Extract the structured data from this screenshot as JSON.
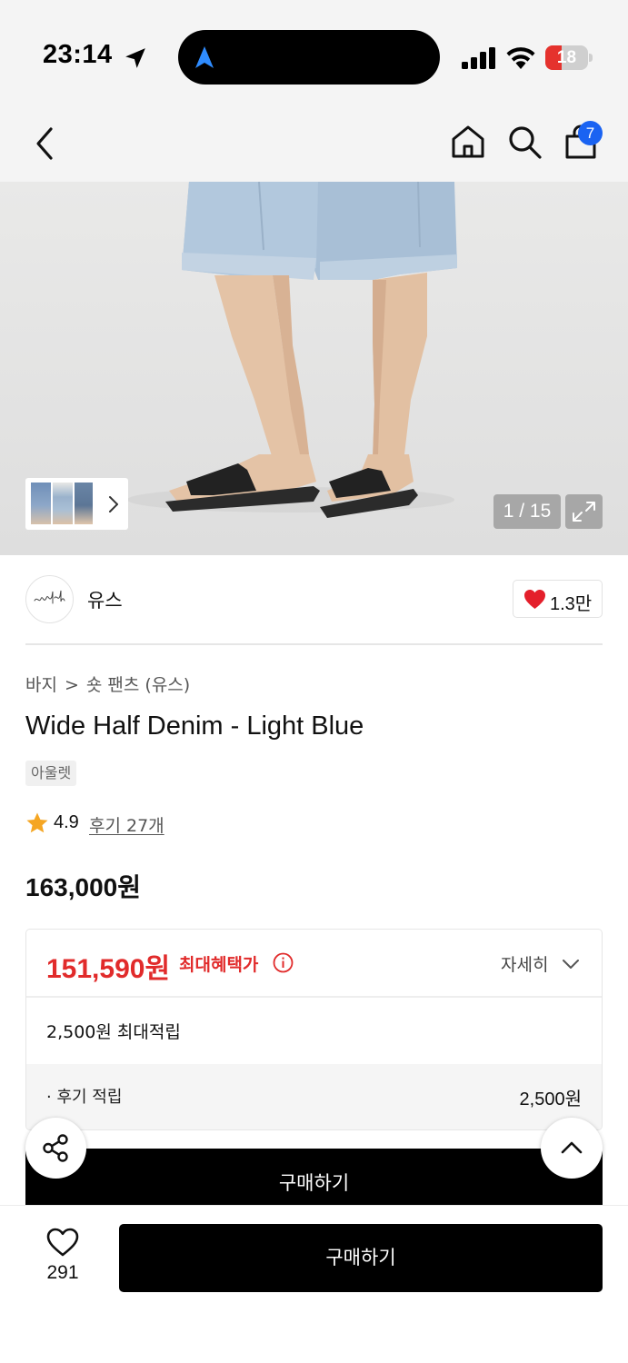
{
  "status_bar": {
    "time": "23:14",
    "battery_level": "18",
    "battery_fraction": 0.18,
    "icons": [
      "location-arrow-icon",
      "navigation-arrow-icon",
      "signal-icon",
      "wifi-icon",
      "battery-icon"
    ]
  },
  "nav": {
    "icons": [
      "back-icon",
      "home-icon",
      "search-icon",
      "cart-icon"
    ],
    "cart_count": "7",
    "accent_color": "#1a63f2"
  },
  "gallery": {
    "page_counter": "1 / 15",
    "icons": [
      "chevron-right-icon",
      "expand-icon"
    ]
  },
  "brand": {
    "logo_text": "youth",
    "name": "유스",
    "like_count": "1.3만"
  },
  "product": {
    "breadcrumb": [
      "바지",
      "숏 팬츠 (유스)"
    ],
    "breadcrumb_separator": ">",
    "title": "Wide Half Denim - Light Blue",
    "tag": "아울렛",
    "rating": "4.9",
    "review_link": "후기 27개",
    "original_price": "163,000원"
  },
  "benefit": {
    "price": "151,590원",
    "label": "최대혜택가",
    "detail_label": "자세히",
    "points_summary": "2,500원 최대적립",
    "points_rows": [
      {
        "label": "· 후기 적립",
        "value": "2,500원"
      }
    ],
    "price_color": "#e12b2b"
  },
  "actions": {
    "inline_buy_label": "구매하기",
    "wish_count": "291",
    "buy_label": "구매하기"
  }
}
